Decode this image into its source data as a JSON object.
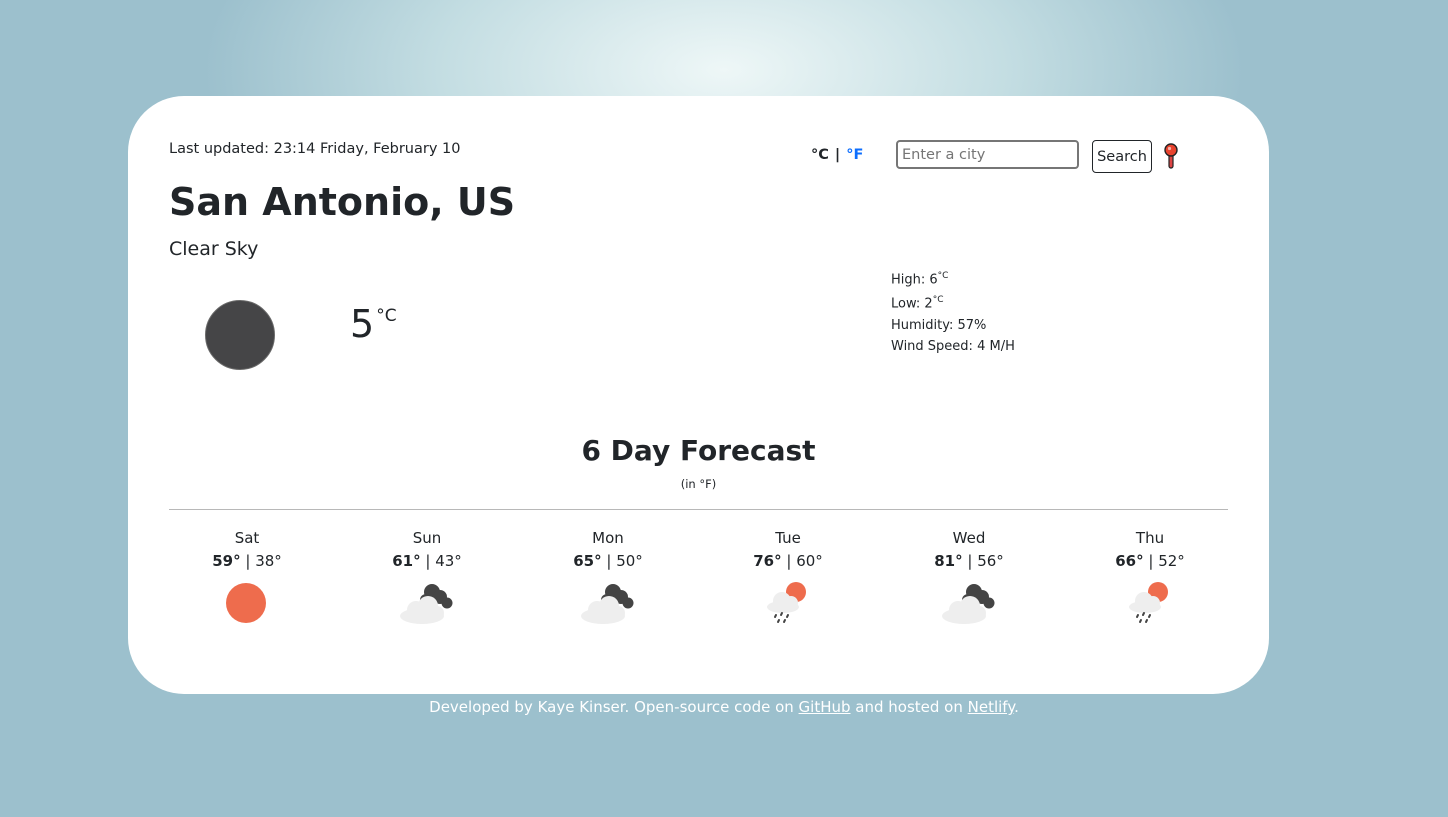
{
  "header": {
    "last_updated_label": "Last updated: 23:14 Friday, February 10",
    "unit_c": "°C",
    "unit_sep": "|",
    "unit_f": "°F",
    "search_placeholder": "Enter a city",
    "search_button": "Search",
    "location_icon": "map-pin-icon"
  },
  "current": {
    "city": "San Antonio, US",
    "description": "Clear Sky",
    "icon": "moon-icon",
    "temp": "5",
    "temp_unit": "°C",
    "high_label": "High: 6",
    "high_unit": "°C",
    "low_label": "Low: 2",
    "low_unit": "°C",
    "humidity": "Humidity: 57%",
    "wind": "Wind Speed: 4 M/H"
  },
  "forecast": {
    "title": "6 Day Forecast",
    "subtitle": "(in °F)",
    "days": [
      {
        "day": "Sat",
        "high": "59°",
        "sep": " | ",
        "low": "38°",
        "icon": "sun-icon"
      },
      {
        "day": "Sun",
        "high": "61°",
        "sep": " | ",
        "low": "43°",
        "icon": "cloudy-icon"
      },
      {
        "day": "Mon",
        "high": "65°",
        "sep": " | ",
        "low": "50°",
        "icon": "cloudy-icon"
      },
      {
        "day": "Tue",
        "high": "76°",
        "sep": " | ",
        "low": "60°",
        "icon": "rain-sun-icon"
      },
      {
        "day": "Wed",
        "high": "81°",
        "sep": " | ",
        "low": "56°",
        "icon": "cloudy-icon"
      },
      {
        "day": "Thu",
        "high": "66°",
        "sep": " | ",
        "low": "52°",
        "icon": "rain-sun-icon"
      }
    ]
  },
  "footer": {
    "text_before": "Developed by Kaye Kinser. Open-source code on ",
    "github_link": "GitHub",
    "text_middle": " and hosted on ",
    "netlify_link": "Netlify",
    "text_after": "."
  },
  "colors": {
    "sun": "#ee6c4d",
    "dark_cloud": "#444444",
    "light_cloud": "#eeeeee",
    "moon": "#454547",
    "accent_link": "#0d6efd"
  }
}
